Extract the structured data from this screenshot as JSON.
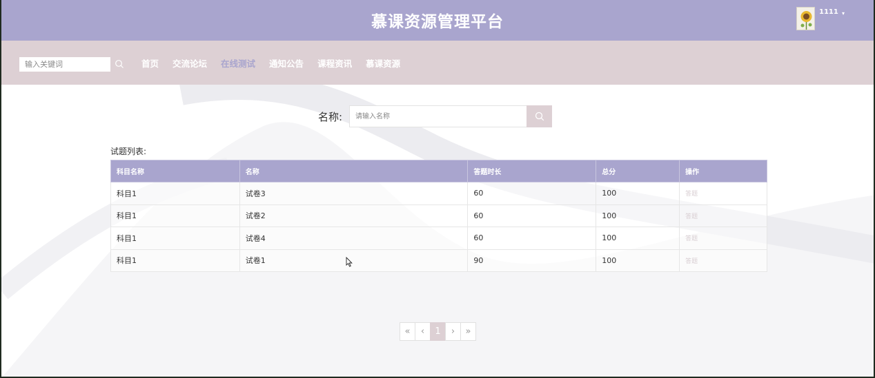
{
  "header": {
    "title": "慕课资源管理平台",
    "username": "1111",
    "caret": "▾"
  },
  "navbar": {
    "search_placeholder": "输入关键词",
    "links": [
      {
        "label": "首页",
        "active": false
      },
      {
        "label": "交流论坛",
        "active": false
      },
      {
        "label": "在线测试",
        "active": true
      },
      {
        "label": "通知公告",
        "active": false
      },
      {
        "label": "课程资讯",
        "active": false
      },
      {
        "label": "慕课资源",
        "active": false
      }
    ]
  },
  "search": {
    "label": "名称:",
    "placeholder": "请输入名称"
  },
  "list": {
    "title": "试题列表:",
    "columns": [
      "科目名称",
      "名称",
      "答题时长",
      "总分",
      "操作"
    ],
    "rows": [
      {
        "subject": "科目1",
        "name": "试卷3",
        "duration": "60",
        "score": "100",
        "action": "答题"
      },
      {
        "subject": "科目1",
        "name": "试卷2",
        "duration": "60",
        "score": "100",
        "action": "答题"
      },
      {
        "subject": "科目1",
        "name": "试卷4",
        "duration": "60",
        "score": "100",
        "action": "答题"
      },
      {
        "subject": "科目1",
        "name": "试卷1",
        "duration": "90",
        "score": "100",
        "action": "答题"
      }
    ]
  },
  "pagination": {
    "first": "«",
    "prev": "‹",
    "current": "1",
    "next": "›",
    "last": "»"
  },
  "colors": {
    "header_bg": "#a9a5ce",
    "navbar_bg": "#ddd0d4",
    "accent": "#a9a5ce"
  }
}
